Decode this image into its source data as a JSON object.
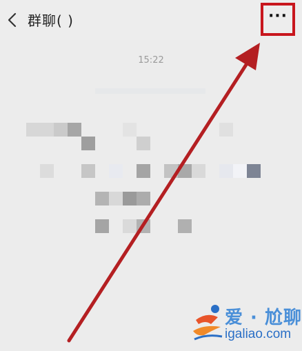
{
  "header": {
    "title": "群聊( )",
    "more_label": "···"
  },
  "chat": {
    "timestamp": "15:22"
  },
  "watermark": {
    "brand": "爱 · 尬聊",
    "url": "igaliao.com"
  },
  "colors": {
    "highlight": "#c8161d",
    "arrow": "#b41f22",
    "background": "#ececec"
  }
}
